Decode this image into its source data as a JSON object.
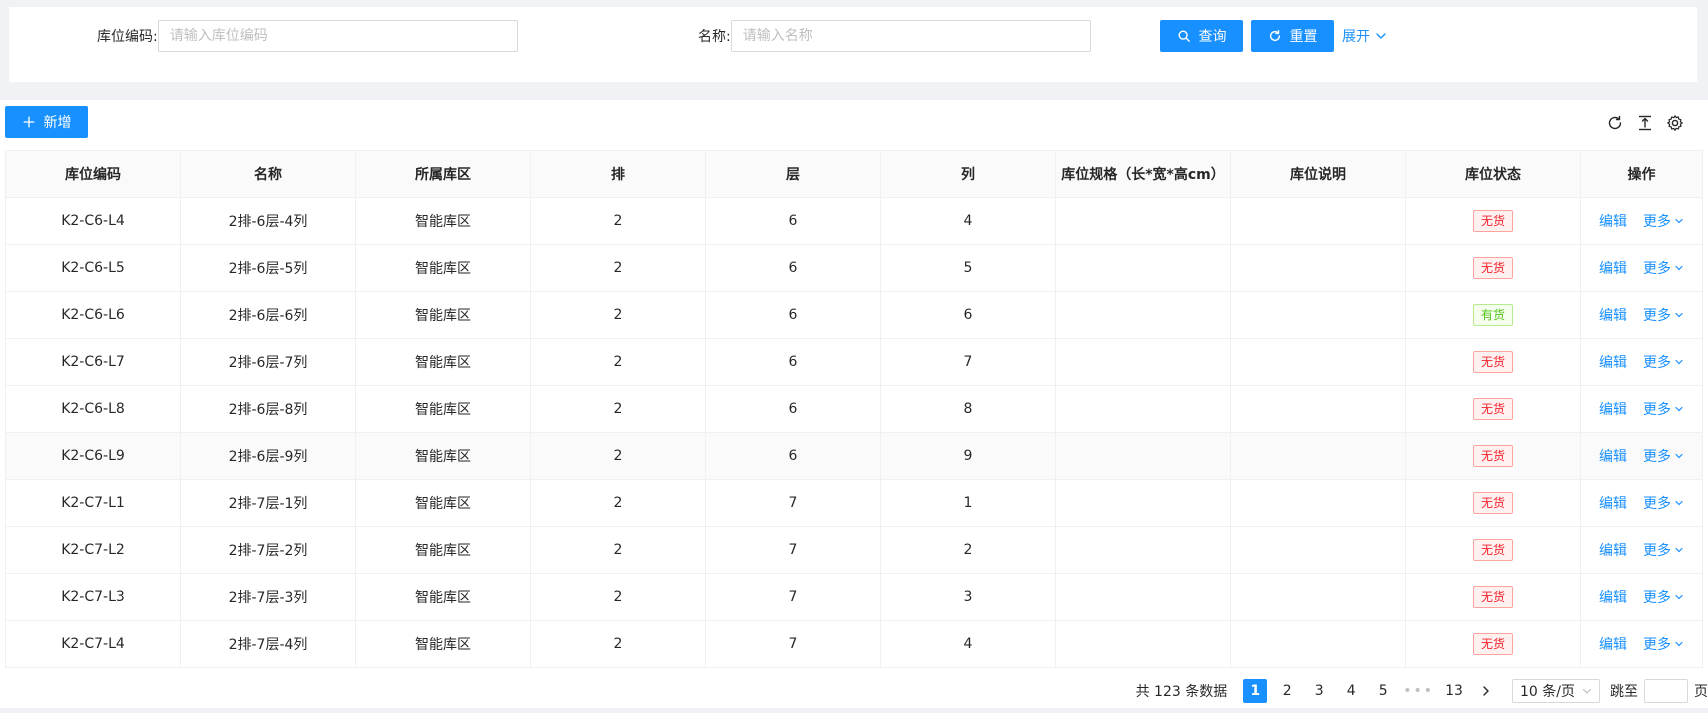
{
  "search": {
    "code_label": "库位编码:",
    "code_placeholder": "请输入库位编码",
    "name_label": "名称:",
    "name_placeholder": "请输入名称",
    "query_label": "查询",
    "reset_label": "重置",
    "expand_label": "展开"
  },
  "toolbar": {
    "add_label": "新增"
  },
  "table": {
    "columns": [
      "库位编码",
      "名称",
      "所属库区",
      "排",
      "层",
      "列",
      "库位规格（长*宽*高cm）",
      "库位说明",
      "库位状态",
      "操作"
    ],
    "edit_label": "编辑",
    "more_label": "更多",
    "rows": [
      {
        "code": "K2-C6-L4",
        "name": "2排-6层-4列",
        "area": "智能库区",
        "row": "2",
        "layer": "6",
        "col": "4",
        "spec": "",
        "desc": "",
        "status": "无货",
        "status_type": "empty"
      },
      {
        "code": "K2-C6-L5",
        "name": "2排-6层-5列",
        "area": "智能库区",
        "row": "2",
        "layer": "6",
        "col": "5",
        "spec": "",
        "desc": "",
        "status": "无货",
        "status_type": "empty"
      },
      {
        "code": "K2-C6-L6",
        "name": "2排-6层-6列",
        "area": "智能库区",
        "row": "2",
        "layer": "6",
        "col": "6",
        "spec": "",
        "desc": "",
        "status": "有货",
        "status_type": "full"
      },
      {
        "code": "K2-C6-L7",
        "name": "2排-6层-7列",
        "area": "智能库区",
        "row": "2",
        "layer": "6",
        "col": "7",
        "spec": "",
        "desc": "",
        "status": "无货",
        "status_type": "empty"
      },
      {
        "code": "K2-C6-L8",
        "name": "2排-6层-8列",
        "area": "智能库区",
        "row": "2",
        "layer": "6",
        "col": "8",
        "spec": "",
        "desc": "",
        "status": "无货",
        "status_type": "empty"
      },
      {
        "code": "K2-C6-L9",
        "name": "2排-6层-9列",
        "area": "智能库区",
        "row": "2",
        "layer": "6",
        "col": "9",
        "spec": "",
        "desc": "",
        "status": "无货",
        "status_type": "empty",
        "highlight": true
      },
      {
        "code": "K2-C7-L1",
        "name": "2排-7层-1列",
        "area": "智能库区",
        "row": "2",
        "layer": "7",
        "col": "1",
        "spec": "",
        "desc": "",
        "status": "无货",
        "status_type": "empty"
      },
      {
        "code": "K2-C7-L2",
        "name": "2排-7层-2列",
        "area": "智能库区",
        "row": "2",
        "layer": "7",
        "col": "2",
        "spec": "",
        "desc": "",
        "status": "无货",
        "status_type": "empty"
      },
      {
        "code": "K2-C7-L3",
        "name": "2排-7层-3列",
        "area": "智能库区",
        "row": "2",
        "layer": "7",
        "col": "3",
        "spec": "",
        "desc": "",
        "status": "无货",
        "status_type": "empty"
      },
      {
        "code": "K2-C7-L4",
        "name": "2排-7层-4列",
        "area": "智能库区",
        "row": "2",
        "layer": "7",
        "col": "4",
        "spec": "",
        "desc": "",
        "status": "无货",
        "status_type": "empty"
      }
    ]
  },
  "pagination": {
    "total_text": "共 123 条数据",
    "pages": [
      "1",
      "2",
      "3",
      "4",
      "5"
    ],
    "current_page": "1",
    "ellipsis": "•••",
    "last_page": "13",
    "page_size": "10 条/页",
    "jump_label": "跳至",
    "jump_suffix": "页"
  },
  "colors": {
    "primary": "#1890ff",
    "tag_empty": "#f5222d",
    "tag_full": "#52c41a"
  }
}
